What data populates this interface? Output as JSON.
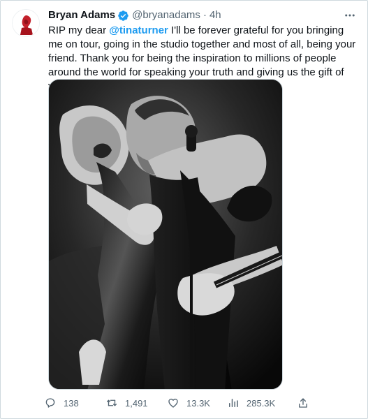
{
  "tweet": {
    "display_name": "Bryan Adams",
    "handle": "@bryanadams",
    "separator": "·",
    "time": "4h",
    "text_before_mention": "RIP my dear ",
    "mention": "@tinaturner",
    "text_after_mention": " I'll be forever grateful for you bringing me on tour, going in the  studio together and most of all, being your friend. Thank you for being  the inspiration to millions of people around the world for speaking your  truth and giving us the gift of your...",
    "verified_icon": "verified-badge-icon",
    "more_icon": "more-dots-icon",
    "avatar_icon": "avatar"
  },
  "media": {
    "photo_icon": "black-and-white-photo"
  },
  "actions": {
    "replies": "138",
    "retweets": "1,491",
    "likes": "13.3K",
    "views": "285.3K",
    "reply_icon": "reply-icon",
    "retweet_icon": "retweet-icon",
    "like_icon": "heart-icon",
    "views_icon": "views-icon",
    "share_icon": "share-icon"
  },
  "colors": {
    "text": "#0f1419",
    "secondary": "#536471",
    "accent": "#1d9bf0",
    "border": "#cfd9de",
    "avatar_red": "#c3202b"
  }
}
